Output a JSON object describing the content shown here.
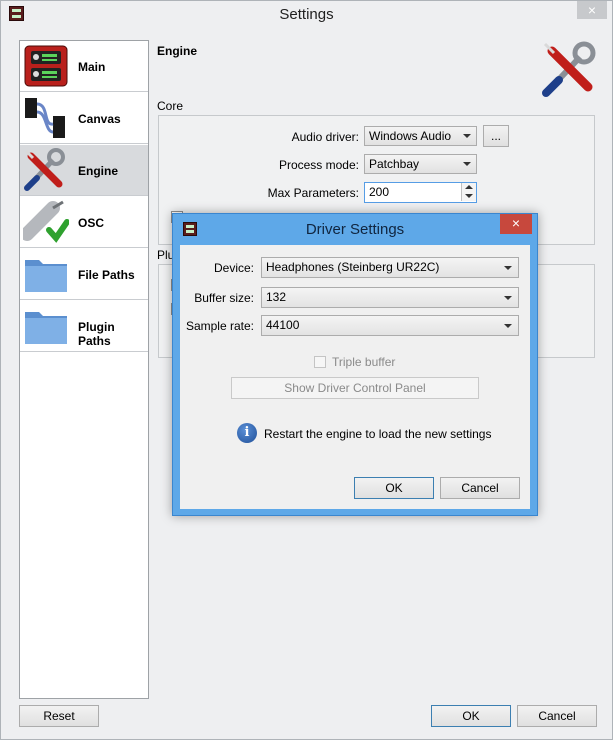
{
  "window": {
    "title": "Settings",
    "close_glyph": "×"
  },
  "sidebar": {
    "items": [
      {
        "label": "Main",
        "icon": "main-rack-icon"
      },
      {
        "label": "Canvas",
        "icon": "canvas-patch-icon"
      },
      {
        "label": "Engine",
        "icon": "engine-tools-icon",
        "active": true
      },
      {
        "label": "OSC",
        "icon": "osc-plug-check-icon"
      },
      {
        "label": "File Paths",
        "icon": "folder-icon"
      },
      {
        "label": "Plugin Paths",
        "icon": "folder-icon"
      }
    ]
  },
  "page": {
    "heading": "Engine",
    "core": {
      "title": "Core",
      "audio_driver_label": "Audio driver:",
      "audio_driver_value": "Windows Audio",
      "driver_settings_button": "...",
      "process_mode_label": "Process mode:",
      "process_mode_value": "Patchbay",
      "max_params_label": "Max Parameters:",
      "max_params_value": "200"
    },
    "plugins_title": "Plu"
  },
  "footer": {
    "reset": "Reset",
    "ok": "OK",
    "cancel": "Cancel"
  },
  "dialog": {
    "title": "Driver Settings",
    "close_glyph": "×",
    "device_label": "Device:",
    "device_value": "Headphones (Steinberg UR22C)",
    "buffer_label": "Buffer size:",
    "buffer_value": "132",
    "sample_rate_label": "Sample rate:",
    "sample_rate_value": "44100",
    "triple_buffer_label": "Triple buffer",
    "triple_buffer_checked": false,
    "control_panel_button": "Show Driver Control Panel",
    "info_glyph": "i",
    "info_text": "Restart the engine to load the new settings",
    "ok": "OK",
    "cancel": "Cancel"
  },
  "colors": {
    "dialog_frame": "#5ea8e8",
    "dialog_close": "#c7483d",
    "focus_border": "#569de5",
    "active_sidebar": "#d8dadd"
  }
}
